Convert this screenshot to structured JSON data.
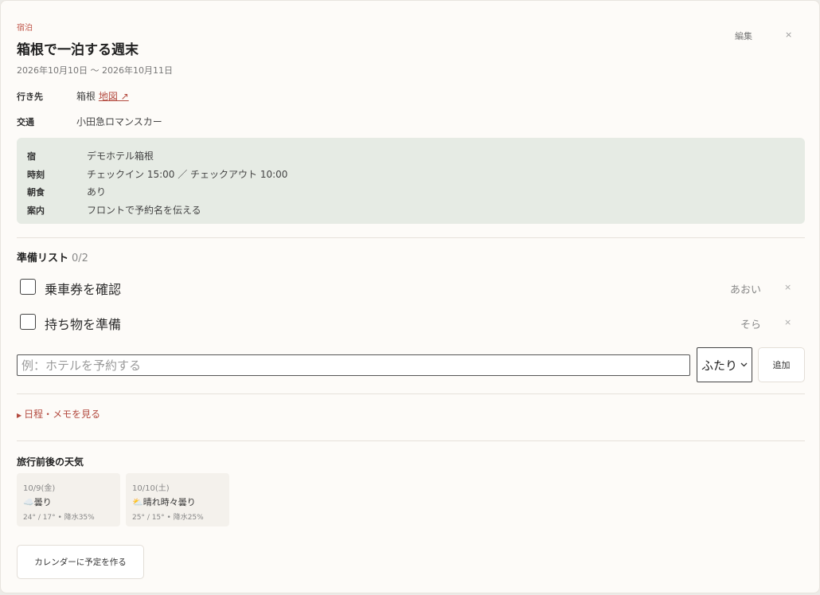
{
  "header": {
    "category": "宿泊",
    "title": "箱根で一泊する週末",
    "dates": "2026年10月10日 〜 2026年10月11日",
    "edit_label": "編集",
    "close_label": "×"
  },
  "details": {
    "destination_label": "行き先",
    "destination_value": "箱根",
    "map_link": "地図 ↗",
    "transport_label": "交通",
    "transport_value": "小田急ロマンスカー"
  },
  "hotel": {
    "rows": [
      {
        "label": "宿",
        "value": "デモホテル箱根"
      },
      {
        "label": "時刻",
        "value": "チェックイン 15:00 ／ チェックアウト 10:00"
      },
      {
        "label": "朝食",
        "value": "あり"
      },
      {
        "label": "案内",
        "value": "フロントで予約名を伝える"
      }
    ]
  },
  "checklist": {
    "title": "準備リスト",
    "count": "0/2",
    "items": [
      {
        "label": "乗車券を確認",
        "assignee": "あおい",
        "delete": "×"
      },
      {
        "label": "持ち物を準備",
        "assignee": "そら",
        "delete": "×"
      }
    ],
    "input_placeholder": "例：ホテルを予約する",
    "assignee_selected": "ふたり",
    "add_label": "追加"
  },
  "memo": {
    "toggle_label": "日程・メモを見る",
    "arrow": "▶"
  },
  "weather": {
    "title": "旅行前後の天気",
    "days": [
      {
        "date": "10/9(金)",
        "icon": "☁️",
        "condition": "曇り",
        "detail": "24° / 17° • 降水35%"
      },
      {
        "date": "10/10(土)",
        "icon": "⛅",
        "condition": "晴れ時々曇り",
        "detail": "25° / 15° • 降水25%"
      }
    ]
  },
  "footer": {
    "calendar_button": "カレンダーに予定を作る"
  },
  "colors": {
    "accent": "#b34a3f",
    "hotel_box_bg": "#e6ebe4",
    "card_bg": "#fdfbf8"
  }
}
